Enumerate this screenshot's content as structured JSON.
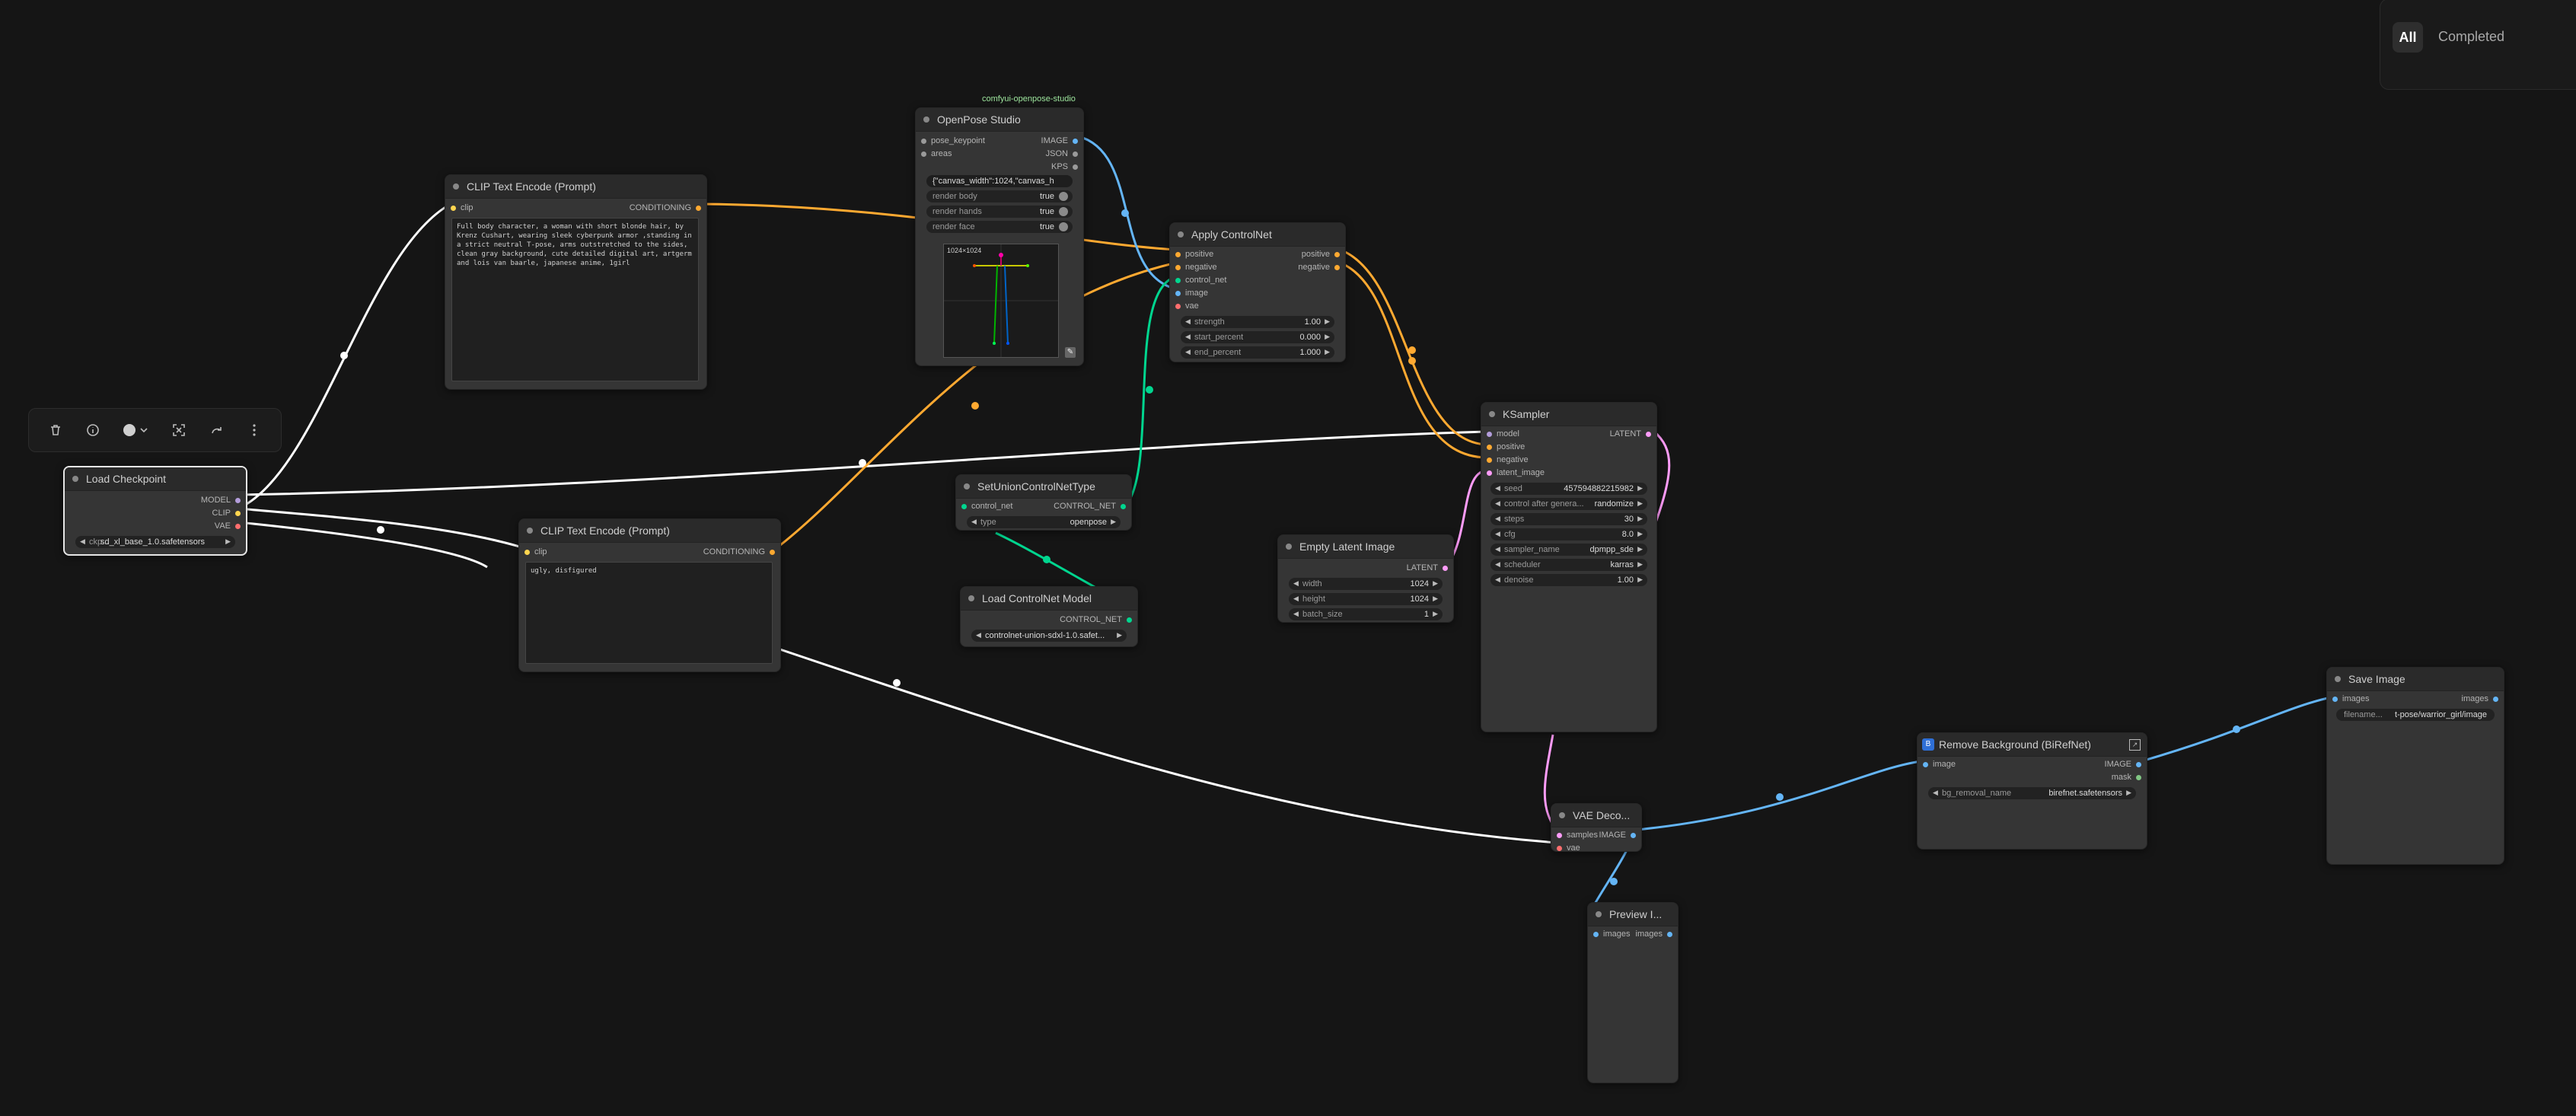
{
  "queue": {
    "tab_all": "All",
    "tab_completed": "Completed"
  },
  "colors": {
    "model": "#b39ddb",
    "clip": "#ffd54f",
    "conditioning": "#ffa931",
    "image": "#64b5f6",
    "latent": "#ff9cf9",
    "vae": "#ff6e6e",
    "control_net": "#00d68f",
    "pose": "#9ee69e"
  },
  "toolbar": {
    "delete_icon": "trash-icon",
    "info_icon": "info-icon",
    "color_icon": "color-circle-icon",
    "fit_icon": "frame-nodes-icon",
    "redo_icon": "redo-icon",
    "more_icon": "more-icon"
  },
  "nodes": {
    "load_checkpoint": {
      "title": "Load Checkpoint",
      "outputs": [
        "MODEL",
        "CLIP",
        "VAE"
      ],
      "widget_label": "ckp...",
      "widget_value": "sd_xl_base_1.0.safetensors"
    },
    "clip_pos": {
      "title": "CLIP Text Encode (Prompt)",
      "input": "clip",
      "output": "CONDITIONING",
      "text": "Full body character, a woman with short blonde hair, by Krenz Cushart, wearing sleek cyberpunk armor ,standing in a strict neutral T-pose, arms outstretched to the sides, clean gray background, cute detailed digital art, artgerm and lois van baarle, japanese anime, 1girl"
    },
    "clip_neg": {
      "title": "CLIP Text Encode (Prompt)",
      "input": "clip",
      "output": "CONDITIONING",
      "text": "ugly, disfigured"
    },
    "openpose": {
      "tag": "comfyui-openpose-studio",
      "title": "OpenPose Studio",
      "inputs": [
        "pose_keypoint",
        "areas"
      ],
      "outputs": [
        "IMAGE",
        "JSON",
        "KPS"
      ],
      "json_value": "{\"canvas_width\":1024,\"canvas_h",
      "toggles": [
        {
          "label": "render body",
          "value": "true"
        },
        {
          "label": "render hands",
          "value": "true"
        },
        {
          "label": "render face",
          "value": "true"
        }
      ],
      "canvas_label": "1024×1024"
    },
    "apply_cn": {
      "title": "Apply ControlNet",
      "inputs": [
        "positive",
        "negative",
        "control_net",
        "image",
        "vae"
      ],
      "outputs": [
        "positive",
        "negative"
      ],
      "widgets": [
        {
          "label": "strength",
          "value": "1.00"
        },
        {
          "label": "start_percent",
          "value": "0.000"
        },
        {
          "label": "end_percent",
          "value": "1.000"
        }
      ]
    },
    "set_union": {
      "title": "SetUnionControlNetType",
      "input": "control_net",
      "output": "CONTROL_NET",
      "widget_label": "type",
      "widget_value": "openpose"
    },
    "load_cn": {
      "title": "Load ControlNet Model",
      "output": "CONTROL_NET",
      "widget_value": "controlnet-union-sdxl-1.0.safet..."
    },
    "empty_latent": {
      "title": "Empty Latent Image",
      "output": "LATENT",
      "widgets": [
        {
          "label": "width",
          "value": "1024"
        },
        {
          "label": "height",
          "value": "1024"
        },
        {
          "label": "batch_size",
          "value": "1"
        }
      ]
    },
    "ksampler": {
      "title": "KSampler",
      "inputs": [
        "model",
        "positive",
        "negative",
        "latent_image"
      ],
      "output": "LATENT",
      "widgets": [
        {
          "label": "seed",
          "value": "457594882215982"
        },
        {
          "label": "control after genera...",
          "value": "randomize"
        },
        {
          "label": "steps",
          "value": "30"
        },
        {
          "label": "cfg",
          "value": "8.0"
        },
        {
          "label": "sampler_name",
          "value": "dpmpp_sde"
        },
        {
          "label": "scheduler",
          "value": "karras"
        },
        {
          "label": "denoise",
          "value": "1.00"
        }
      ]
    },
    "vae_decode": {
      "title": "VAE Deco...",
      "inputs": [
        "samples",
        "vae"
      ],
      "output": "IMAGE"
    },
    "preview": {
      "title": "Preview I...",
      "input": "images",
      "output": "images"
    },
    "remove_bg": {
      "title": "Remove Background (BiRefNet)",
      "input": "image",
      "outputs": [
        "IMAGE",
        "mask"
      ],
      "widget_label": "bg_removal_name",
      "widget_value": "birefnet.safetensors"
    },
    "save_image": {
      "title": "Save Image",
      "input": "images",
      "output": "images",
      "widget_label": "filename...",
      "widget_value": "t-pose/warrior_girl/image"
    }
  }
}
